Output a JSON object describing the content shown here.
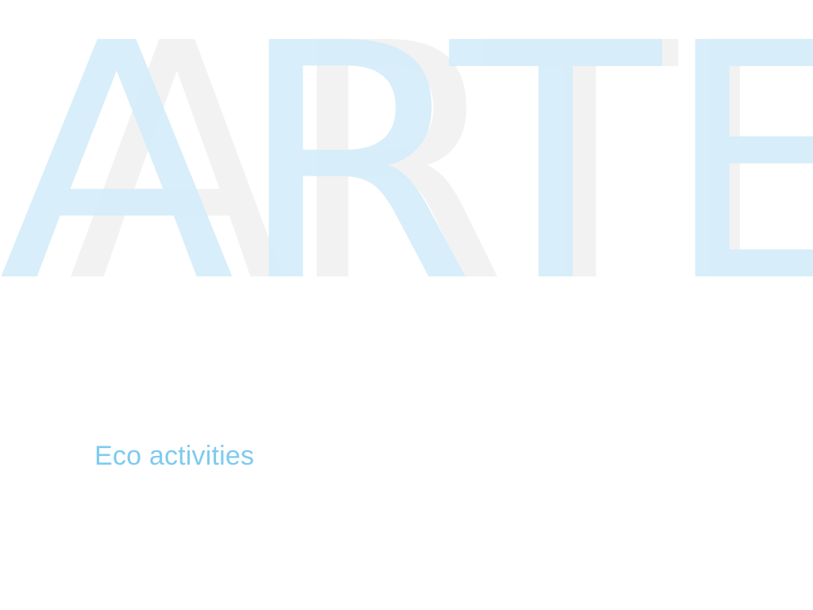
{
  "watermark": {
    "back_text": "ARTE",
    "front_text": "ARTE",
    "back_color": "#f2f2f2",
    "front_color": "#d4ecf9"
  },
  "section": {
    "title": "Eco activities",
    "title_color": "#7ecbef"
  }
}
